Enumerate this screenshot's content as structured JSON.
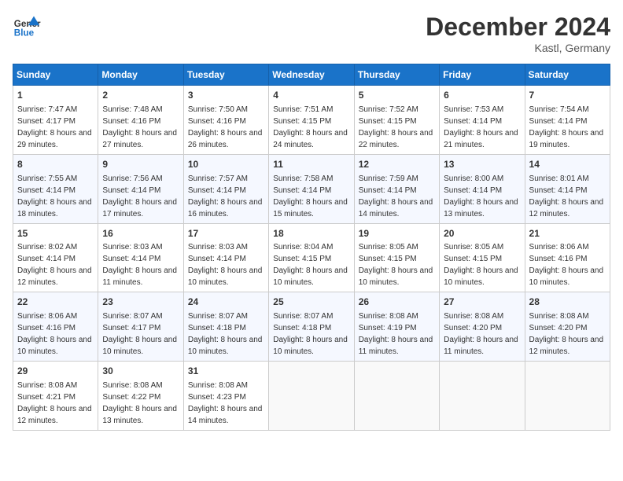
{
  "header": {
    "logo_line1": "General",
    "logo_line2": "Blue",
    "month": "December 2024",
    "location": "Kastl, Germany"
  },
  "days": [
    "Sunday",
    "Monday",
    "Tuesday",
    "Wednesday",
    "Thursday",
    "Friday",
    "Saturday"
  ],
  "weeks": [
    [
      {
        "day": "1",
        "sunrise": "7:47 AM",
        "sunset": "4:17 PM",
        "daylight": "8 hours and 29 minutes."
      },
      {
        "day": "2",
        "sunrise": "7:48 AM",
        "sunset": "4:16 PM",
        "daylight": "8 hours and 27 minutes."
      },
      {
        "day": "3",
        "sunrise": "7:50 AM",
        "sunset": "4:16 PM",
        "daylight": "8 hours and 26 minutes."
      },
      {
        "day": "4",
        "sunrise": "7:51 AM",
        "sunset": "4:15 PM",
        "daylight": "8 hours and 24 minutes."
      },
      {
        "day": "5",
        "sunrise": "7:52 AM",
        "sunset": "4:15 PM",
        "daylight": "8 hours and 22 minutes."
      },
      {
        "day": "6",
        "sunrise": "7:53 AM",
        "sunset": "4:14 PM",
        "daylight": "8 hours and 21 minutes."
      },
      {
        "day": "7",
        "sunrise": "7:54 AM",
        "sunset": "4:14 PM",
        "daylight": "8 hours and 19 minutes."
      }
    ],
    [
      {
        "day": "8",
        "sunrise": "7:55 AM",
        "sunset": "4:14 PM",
        "daylight": "8 hours and 18 minutes."
      },
      {
        "day": "9",
        "sunrise": "7:56 AM",
        "sunset": "4:14 PM",
        "daylight": "8 hours and 17 minutes."
      },
      {
        "day": "10",
        "sunrise": "7:57 AM",
        "sunset": "4:14 PM",
        "daylight": "8 hours and 16 minutes."
      },
      {
        "day": "11",
        "sunrise": "7:58 AM",
        "sunset": "4:14 PM",
        "daylight": "8 hours and 15 minutes."
      },
      {
        "day": "12",
        "sunrise": "7:59 AM",
        "sunset": "4:14 PM",
        "daylight": "8 hours and 14 minutes."
      },
      {
        "day": "13",
        "sunrise": "8:00 AM",
        "sunset": "4:14 PM",
        "daylight": "8 hours and 13 minutes."
      },
      {
        "day": "14",
        "sunrise": "8:01 AM",
        "sunset": "4:14 PM",
        "daylight": "8 hours and 12 minutes."
      }
    ],
    [
      {
        "day": "15",
        "sunrise": "8:02 AM",
        "sunset": "4:14 PM",
        "daylight": "8 hours and 12 minutes."
      },
      {
        "day": "16",
        "sunrise": "8:03 AM",
        "sunset": "4:14 PM",
        "daylight": "8 hours and 11 minutes."
      },
      {
        "day": "17",
        "sunrise": "8:03 AM",
        "sunset": "4:14 PM",
        "daylight": "8 hours and 10 minutes."
      },
      {
        "day": "18",
        "sunrise": "8:04 AM",
        "sunset": "4:15 PM",
        "daylight": "8 hours and 10 minutes."
      },
      {
        "day": "19",
        "sunrise": "8:05 AM",
        "sunset": "4:15 PM",
        "daylight": "8 hours and 10 minutes."
      },
      {
        "day": "20",
        "sunrise": "8:05 AM",
        "sunset": "4:15 PM",
        "daylight": "8 hours and 10 minutes."
      },
      {
        "day": "21",
        "sunrise": "8:06 AM",
        "sunset": "4:16 PM",
        "daylight": "8 hours and 10 minutes."
      }
    ],
    [
      {
        "day": "22",
        "sunrise": "8:06 AM",
        "sunset": "4:16 PM",
        "daylight": "8 hours and 10 minutes."
      },
      {
        "day": "23",
        "sunrise": "8:07 AM",
        "sunset": "4:17 PM",
        "daylight": "8 hours and 10 minutes."
      },
      {
        "day": "24",
        "sunrise": "8:07 AM",
        "sunset": "4:18 PM",
        "daylight": "8 hours and 10 minutes."
      },
      {
        "day": "25",
        "sunrise": "8:07 AM",
        "sunset": "4:18 PM",
        "daylight": "8 hours and 10 minutes."
      },
      {
        "day": "26",
        "sunrise": "8:08 AM",
        "sunset": "4:19 PM",
        "daylight": "8 hours and 11 minutes."
      },
      {
        "day": "27",
        "sunrise": "8:08 AM",
        "sunset": "4:20 PM",
        "daylight": "8 hours and 11 minutes."
      },
      {
        "day": "28",
        "sunrise": "8:08 AM",
        "sunset": "4:20 PM",
        "daylight": "8 hours and 12 minutes."
      }
    ],
    [
      {
        "day": "29",
        "sunrise": "8:08 AM",
        "sunset": "4:21 PM",
        "daylight": "8 hours and 12 minutes."
      },
      {
        "day": "30",
        "sunrise": "8:08 AM",
        "sunset": "4:22 PM",
        "daylight": "8 hours and 13 minutes."
      },
      {
        "day": "31",
        "sunrise": "8:08 AM",
        "sunset": "4:23 PM",
        "daylight": "8 hours and 14 minutes."
      },
      null,
      null,
      null,
      null
    ]
  ],
  "labels": {
    "sunrise": "Sunrise: ",
    "sunset": "Sunset: ",
    "daylight": "Daylight: "
  }
}
